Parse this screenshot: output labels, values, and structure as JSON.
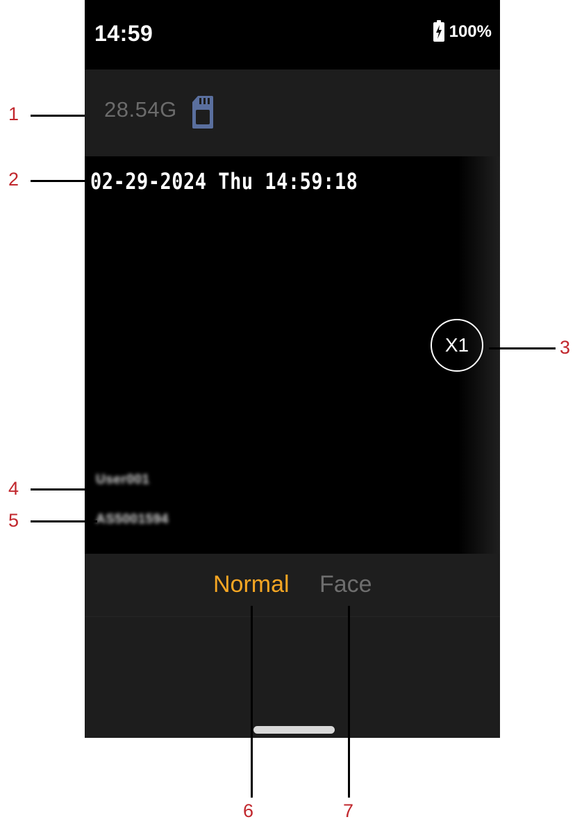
{
  "status_bar": {
    "time": "14:59",
    "battery_percent": "100%"
  },
  "storage": {
    "free_space": "28.54G",
    "icon": "sd-card-icon"
  },
  "preview": {
    "osd_datetime": "02-29-2024 Thu 14:59:18",
    "zoom_label": "X1",
    "osd_user": "User001",
    "osd_device_id": "AS5001594"
  },
  "modes": {
    "normal": "Normal",
    "face": "Face",
    "active_color": "#f5a623"
  },
  "callouts": [
    "1",
    "2",
    "3",
    "4",
    "5",
    "6",
    "7"
  ],
  "colors": {
    "callout_number": "#c1272d",
    "callout_line": "#000000"
  }
}
